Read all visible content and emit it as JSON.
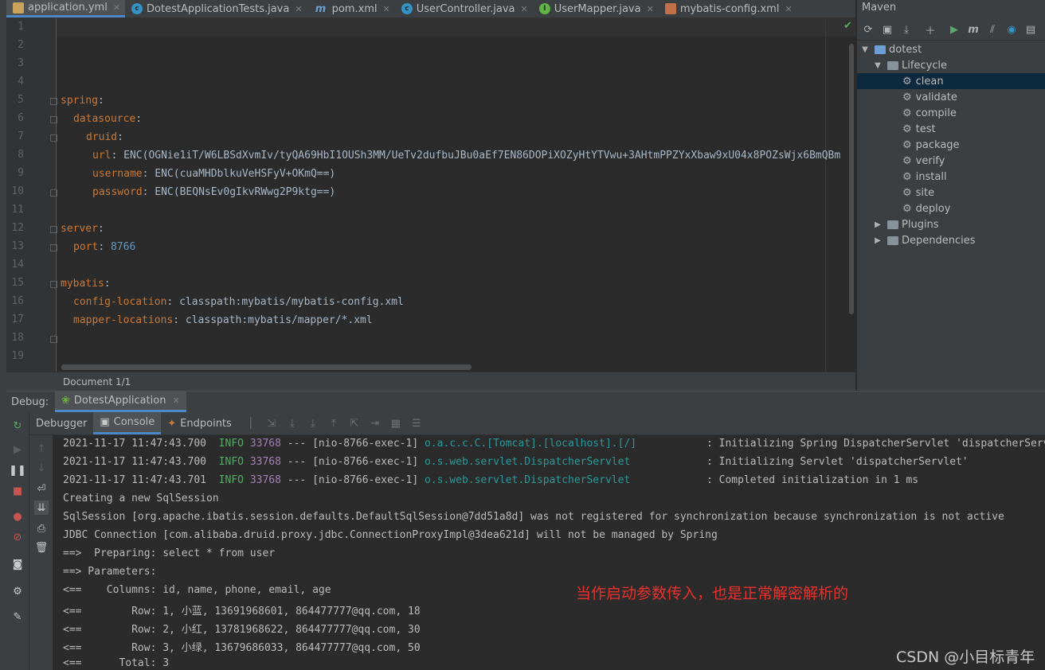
{
  "editor_tabs": [
    {
      "label": "application.yml",
      "icon": "yaml-file-icon",
      "active": true
    },
    {
      "label": "DotestApplicationTests.java",
      "icon": "java-class-icon",
      "active": false
    },
    {
      "label": "pom.xml",
      "icon": "maven-icon",
      "active": false
    },
    {
      "label": "UserController.java",
      "icon": "java-class-icon",
      "active": false
    },
    {
      "label": "UserMapper.java",
      "icon": "java-interface-icon",
      "active": false
    },
    {
      "label": "mybatis-config.xml",
      "icon": "xml-file-icon",
      "active": false
    }
  ],
  "editor": {
    "line_numbers": [
      "1",
      "2",
      "3",
      "4",
      "5",
      "6",
      "7",
      "8",
      "9",
      "10",
      "11",
      "12",
      "13",
      "14",
      "15",
      "16",
      "17",
      "18",
      "19"
    ],
    "lines": {
      "l5_key": "spring",
      "l6_key": "datasource",
      "l7_key": "druid",
      "l8_key": "url",
      "l8_val": "ENC(OGNie1iT/W6LBSdXvmIv/tyQA69HbI1OUSh3MM/UeTv2dufbuJBu0aEf7EN86DOPiXOZyHtYTVwu+3AHtmPPZYxXbaw9xU04x8POZsWjx6BmQBm",
      "l9_key": "username",
      "l9_val": "ENC(cuaMHDblkuVeHSFyV+OKmQ==)",
      "l10_key": "password",
      "l10_val": "ENC(BEQNsEv0gIkvRWwg2P9ktg==)",
      "l12_key": "server",
      "l13_key": "port",
      "l13_val": "8766",
      "l15_key": "mybatis",
      "l16_key": "config-location",
      "l16_val": "classpath:mybatis/mybatis-config.xml",
      "l17_key": "mapper-locations",
      "l17_val": "classpath:mybatis/mapper/*.xml"
    },
    "status": "Document 1/1"
  },
  "maven": {
    "title": "Maven",
    "project": "dotest",
    "lifecycle_label": "Lifecycle",
    "goals": [
      "clean",
      "validate",
      "compile",
      "test",
      "package",
      "verify",
      "install",
      "site",
      "deploy"
    ],
    "selected_goal": "clean",
    "plugins_label": "Plugins",
    "dependencies_label": "Dependencies"
  },
  "debug": {
    "label": "Debug:",
    "session_tab": "DotestApplication",
    "tabs": [
      "Debugger",
      "Console",
      "Endpoints"
    ],
    "active_tab": "Console"
  },
  "console": {
    "log_lines": [
      {
        "ts": "2021-11-17 11:47:43.700",
        "level": "INFO",
        "pid": "33768",
        "sep": "---",
        "thread": "[nio-8766-exec-1]",
        "logger": "o.a.c.c.C.[Tomcat].[localhost].[/]",
        "msg": ": Initializing Spring DispatcherServlet 'dispatcherServ"
      },
      {
        "ts": "2021-11-17 11:47:43.700",
        "level": "INFO",
        "pid": "33768",
        "sep": "---",
        "thread": "[nio-8766-exec-1]",
        "logger": "o.s.web.servlet.DispatcherServlet",
        "msg": ": Initializing Servlet 'dispatcherServlet'"
      },
      {
        "ts": "2021-11-17 11:47:43.701",
        "level": "INFO",
        "pid": "33768",
        "sep": "---",
        "thread": "[nio-8766-exec-1]",
        "logger": "o.s.web.servlet.DispatcherServlet",
        "msg": ": Completed initialization in 1 ms"
      }
    ],
    "plain_lines": [
      "Creating a new SqlSession",
      "SqlSession [org.apache.ibatis.session.defaults.DefaultSqlSession@7dd51a8d] was not registered for synchronization because synchronization is not active",
      "JDBC Connection [com.alibaba.druid.proxy.jdbc.ConnectionProxyImpl@3dea621d] will not be managed by Spring",
      "==>  Preparing: select * from user",
      "==> Parameters: ",
      "<==    Columns: id, name, phone, email, age",
      "<==        Row: 1, 小蓝, 13691968601, 864477777@qq.com, 18",
      "<==        Row: 2, 小红, 13781968622, 864477777@qq.com, 30",
      "<==        Row: 3, 小绿, 13679686033, 864477777@qq.com, 50",
      "<==      Total: 3"
    ]
  },
  "annotation": "当作启动参数传入，也是正常解密解析的",
  "watermark": "CSDN @小目标青年",
  "colors": {
    "background": "#2b2b2b",
    "panel": "#3c3f41",
    "accent": "#4a88c7",
    "yaml_key": "#cc7832",
    "number": "#6897bb",
    "info": "#59a869",
    "annotation": "#e8312d"
  }
}
